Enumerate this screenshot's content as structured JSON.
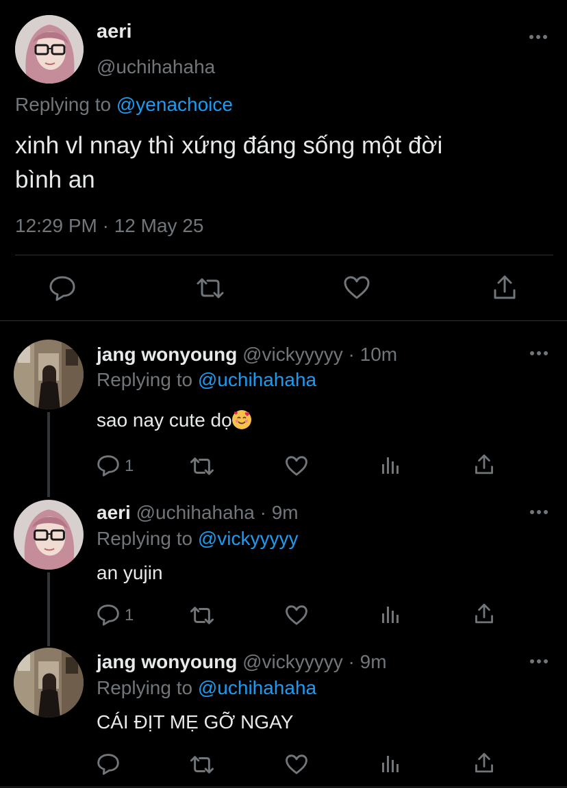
{
  "main_tweet": {
    "name": "aeri",
    "handle": "@uchihahaha",
    "replying_label": "Replying to",
    "replying_to": "@yenachoice",
    "text_line1": "xinh vl nnay thì xứng đáng sống một đời",
    "text_line2": "bình an",
    "timestamp": "12:29 PM · 12 May 25",
    "avatar_icon": "avatar-pink-hair-glasses"
  },
  "replies": [
    {
      "name": "jang wonyoung",
      "meta": "@vickyyyyy · 10m",
      "replying_label": "Replying to",
      "replying_to": "@uchihahaha",
      "text": "sao nay cute dọ",
      "emoji": "smiling-face-with-hearts",
      "reply_count": "1",
      "avatar_icon": "avatar-street-photo"
    },
    {
      "name": "aeri",
      "meta": "@uchihahaha · 9m",
      "replying_label": "Replying to",
      "replying_to": "@vickyyyyy",
      "text": "an yujin",
      "reply_count": "1",
      "avatar_icon": "avatar-pink-hair-glasses"
    },
    {
      "name": "jang wonyoung",
      "meta": "@vickyyyyy · 9m",
      "replying_label": "Replying to",
      "replying_to": "@uchihahaha",
      "text": "CÁI ĐỊT MẸ GỠ NGAY",
      "reply_count": "",
      "avatar_icon": "avatar-street-photo"
    }
  ],
  "colors": {
    "background": "#000000",
    "text": "#e7e9ea",
    "secondary": "#71767b",
    "link": "#1d9bf0",
    "divider": "#2f3336"
  }
}
